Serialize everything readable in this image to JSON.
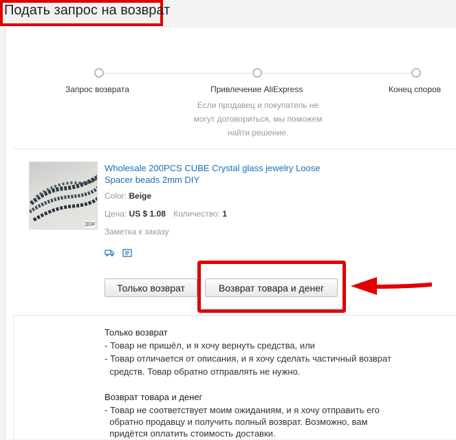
{
  "header": {
    "title": "Подать запрос на возврат"
  },
  "steps": [
    {
      "label": "Запрос возврата"
    },
    {
      "label": "Привлечение AliExpress",
      "description": "Если продавец и покупатель не могут договориться, мы поможем найти решение."
    },
    {
      "label": "Конец споров"
    }
  ],
  "product": {
    "title": "Wholesale 200PCS CUBE Crystal glass jewelry Loose Spacer beads 2mm DIY",
    "color_label": "Color:",
    "color_value": "Beige",
    "price_label": "Цена:",
    "price_value": "US $ 1.08",
    "qty_label": "Количество:",
    "qty_value": "1",
    "note": "Заметка к заказу",
    "thumb_badge": "30#"
  },
  "actions": {
    "refund_only": "Только возврат",
    "return_and_refund": "Возврат товара и денег"
  },
  "info": {
    "refund_only_title": "Только возврат",
    "refund_only_lines": [
      "- Товар не пришёл, и я хочу вернуть средства, или",
      "- Товар отличается от описания, и я хочу сделать частичный возврат",
      "  средств. Товар обратно отправлять не нужно."
    ],
    "return_title": "Возврат товара и денег",
    "return_lines": [
      "- Товар не соответствует моим ожиданиям, и я хочу отправить его",
      "  обратно продавцу и получить полный возврат. Возможно, вам",
      "  придётся оплатить стоимость доставки."
    ]
  },
  "colors": {
    "highlight": "#e00000",
    "link": "#1a6fb2"
  }
}
